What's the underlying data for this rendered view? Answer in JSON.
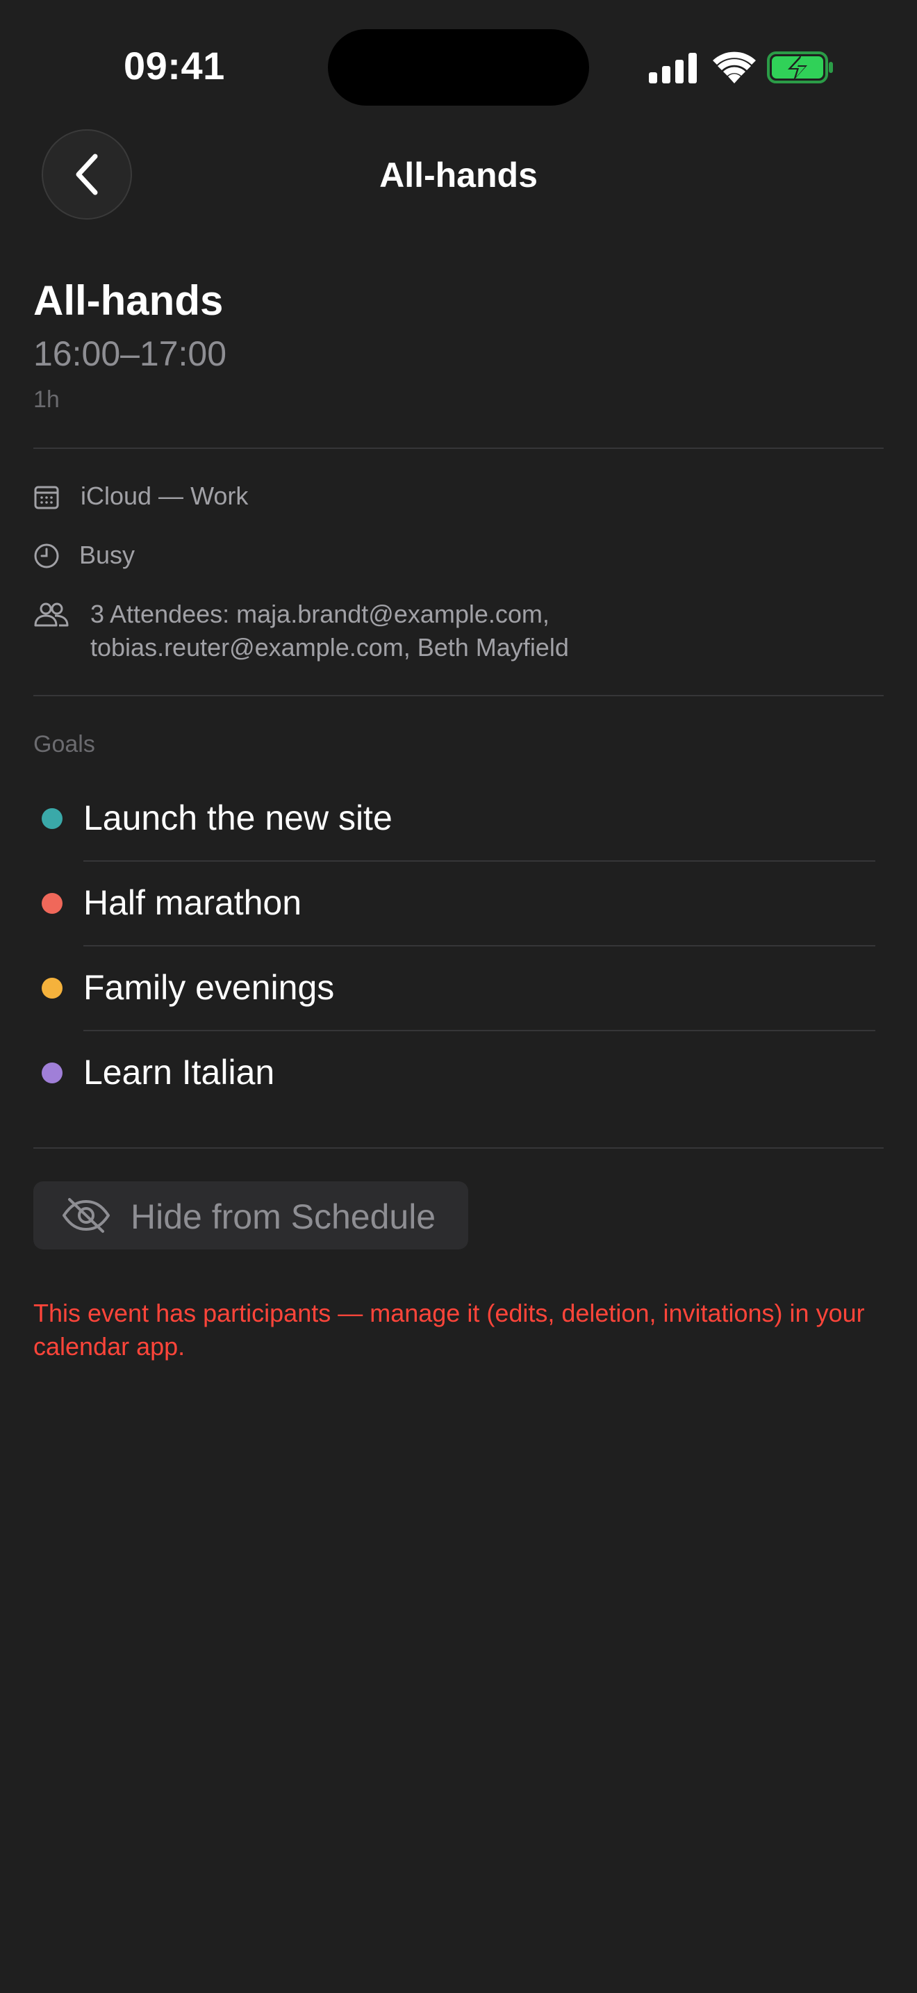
{
  "status_bar": {
    "time": "09:41",
    "icons": [
      "signal-icon",
      "wifi-icon",
      "battery-charging-icon"
    ],
    "battery_color": "#30d158"
  },
  "nav": {
    "back_icon": "chevron-left-icon",
    "title": "All-hands"
  },
  "event": {
    "title": "All-hands",
    "time_range": "16:00–17:00",
    "duration": "1h"
  },
  "details": {
    "calendar": {
      "icon": "calendar-icon",
      "text": "iCloud — Work"
    },
    "availability": {
      "icon": "clock-icon",
      "text": "Busy"
    },
    "attendees": {
      "icon": "people-icon",
      "line1": "3 Attendees: maja.brandt@example.com,",
      "line2": "tobias.reuter@example.com, Beth Mayfield"
    }
  },
  "goals": {
    "label": "Goals",
    "items": [
      {
        "label": "Launch the new site",
        "color": "#3aa9a9"
      },
      {
        "label": "Half marathon",
        "color": "#f0685a"
      },
      {
        "label": "Family evenings",
        "color": "#f5b23c"
      },
      {
        "label": "Learn Italian",
        "color": "#a07fd8"
      }
    ]
  },
  "hide_button": {
    "icon": "eye-slash-icon",
    "label": "Hide from Schedule"
  },
  "warning": "This event has participants — manage it (edits, deletion, invitations) in your calendar app.",
  "colors": {
    "background": "#1f1f1f",
    "accent_warning": "#ff453a",
    "secondary_text": "#8e8e93"
  }
}
